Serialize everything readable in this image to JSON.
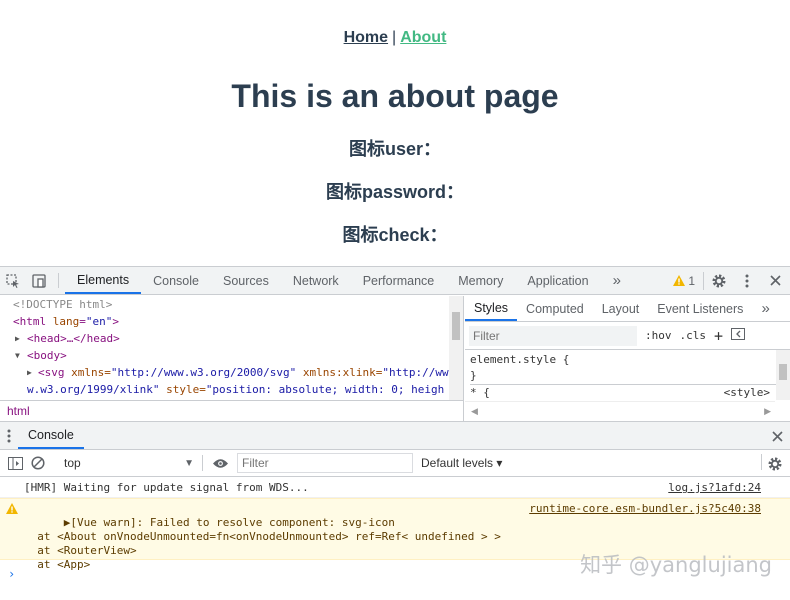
{
  "page": {
    "nav": {
      "home": "Home",
      "separator": "|",
      "about": "About"
    },
    "title": "This is an about page",
    "icon_lines": [
      "图标user：",
      "图标password：",
      "图标check："
    ]
  },
  "devtools": {
    "tabs": [
      "Elements",
      "Console",
      "Sources",
      "Network",
      "Performance",
      "Memory",
      "Application"
    ],
    "more": "»",
    "warning_count": "1",
    "elements": {
      "doctype": "<!DOCTYPE html>",
      "html_tag": "html",
      "html_attr": "lang",
      "html_val": "\"en\"",
      "head": "<head>…</head>",
      "body": "<body>",
      "svg_line1_tag": "<svg",
      "svg_line1_attr1": " xmlns=",
      "svg_line1_val1": "\"http://www.w3.org/2000/svg\"",
      "svg_line1_attr2": " xmlns:xlink=",
      "svg_line1_val2": "\"http://ww",
      "svg_line2_val": "w.w3.org/1999/xlink\"",
      "svg_line2_attr": " style=",
      "svg_line2_val2": "\"position: absolute; width: 0; heigh"
    },
    "breadcrumb": "html",
    "styles": {
      "tabs": [
        "Styles",
        "Computed",
        "Layout",
        "Event Listeners"
      ],
      "more": "»",
      "filter_placeholder": "Filter",
      "hov": ":hov",
      "cls": ".cls",
      "plus": "+",
      "rule1": "element.style {",
      "rule1_end": "}",
      "rule2": "* {",
      "rule2_src": "<style>"
    },
    "drawer": {
      "tab": "Console",
      "context": "top",
      "filter_placeholder": "Filter",
      "levels": "Default levels ▾",
      "logs": {
        "hmr_text": "[HMR] Waiting for update signal from WDS...",
        "hmr_src": "log.js?1afd:24",
        "warn_text": "▶[Vue warn]: Failed to resolve component: svg-icon\n  at <About onVnodeUnmounted=fn<onVnodeUnmounted> ref=Ref< undefined > >\n  at <RouterView>\n  at <App>",
        "warn_src": "runtime-core.esm-bundler.js?5c40:38"
      },
      "prompt": "›",
      "watermark": "知乎 @yanglujiang"
    }
  },
  "colors": {
    "accent": "#42b983",
    "text": "#2c3e50",
    "devtools_blue": "#1a73e8",
    "warning_bg": "#fffbe5"
  },
  "icons": [
    "inspect-icon",
    "device-toolbar-icon",
    "warning-icon",
    "gear-icon",
    "more-vert-icon",
    "close-icon",
    "console-sidebar-icon",
    "clear-icon",
    "eye-icon"
  ]
}
